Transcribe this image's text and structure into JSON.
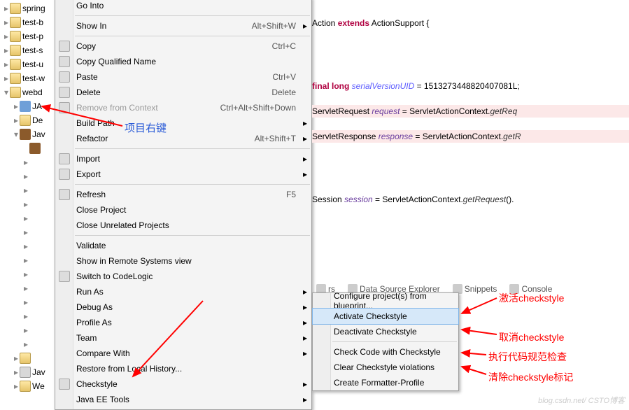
{
  "tree": {
    "items": [
      {
        "label": "spring",
        "icon": "ic-folder",
        "indent": 0,
        "tw": "▸"
      },
      {
        "label": "test-b",
        "icon": "ic-folder",
        "indent": 0,
        "tw": "▸"
      },
      {
        "label": "test-p",
        "icon": "ic-folder",
        "indent": 0,
        "tw": "▸"
      },
      {
        "label": "test-s",
        "icon": "ic-folder",
        "indent": 0,
        "tw": "▸"
      },
      {
        "label": "test-u",
        "icon": "ic-folder",
        "indent": 0,
        "tw": "▸"
      },
      {
        "label": "test-w",
        "icon": "ic-folder",
        "indent": 0,
        "tw": "▸"
      },
      {
        "label": "webd",
        "icon": "ic-folder",
        "indent": 0,
        "tw": "▾"
      },
      {
        "label": "JA",
        "icon": "ic-java",
        "indent": 1,
        "tw": "▸"
      },
      {
        "label": "De",
        "icon": "ic-folder",
        "indent": 1,
        "tw": "▸"
      },
      {
        "label": "Jav",
        "icon": "ic-pkg",
        "indent": 1,
        "tw": "▾"
      },
      {
        "label": "",
        "icon": "ic-pkg",
        "indent": 2,
        "tw": ""
      },
      {
        "label": "",
        "icon": "",
        "indent": 2,
        "tw": "▸"
      },
      {
        "label": "",
        "icon": "",
        "indent": 2,
        "tw": "▸"
      },
      {
        "label": "",
        "icon": "",
        "indent": 2,
        "tw": "▸"
      },
      {
        "label": "",
        "icon": "",
        "indent": 2,
        "tw": "▸"
      },
      {
        "label": "",
        "icon": "",
        "indent": 2,
        "tw": "▸"
      },
      {
        "label": "",
        "icon": "",
        "indent": 2,
        "tw": "▸"
      },
      {
        "label": "",
        "icon": "",
        "indent": 2,
        "tw": "▸"
      },
      {
        "label": "",
        "icon": "",
        "indent": 2,
        "tw": "▸"
      },
      {
        "label": "",
        "icon": "",
        "indent": 2,
        "tw": "▸"
      },
      {
        "label": "",
        "icon": "",
        "indent": 2,
        "tw": "▸"
      },
      {
        "label": "",
        "icon": "",
        "indent": 2,
        "tw": "▸"
      },
      {
        "label": "",
        "icon": "",
        "indent": 2,
        "tw": "▸"
      },
      {
        "label": "",
        "icon": "",
        "indent": 2,
        "tw": "▸"
      },
      {
        "label": "",
        "icon": "",
        "indent": 2,
        "tw": "▸"
      },
      {
        "label": "",
        "icon": "ic-folder",
        "indent": 1,
        "tw": "▸"
      },
      {
        "label": "Jav",
        "icon": "ic-lib",
        "indent": 1,
        "tw": "▸"
      },
      {
        "label": "We",
        "icon": "ic-folder",
        "indent": 1,
        "tw": "▸"
      }
    ]
  },
  "menu1": {
    "groups": [
      [
        {
          "label": "Go Into",
          "shortcut": "",
          "sub": false
        }
      ],
      [
        {
          "label": "Show In",
          "shortcut": "Alt+Shift+W",
          "sub": true
        }
      ],
      [
        {
          "label": "Copy",
          "shortcut": "Ctrl+C",
          "sub": false,
          "icon": "copy"
        },
        {
          "label": "Copy Qualified Name",
          "shortcut": "",
          "sub": false,
          "icon": "copy"
        },
        {
          "label": "Paste",
          "shortcut": "Ctrl+V",
          "sub": false,
          "icon": "paste"
        },
        {
          "label": "Delete",
          "shortcut": "Delete",
          "sub": false,
          "icon": "delete"
        },
        {
          "label": "Remove from Context",
          "shortcut": "Ctrl+Alt+Shift+Down",
          "sub": false,
          "disabled": true,
          "icon": "remove"
        },
        {
          "label": "Build Path",
          "shortcut": "",
          "sub": true
        },
        {
          "label": "Refactor",
          "shortcut": "Alt+Shift+T",
          "sub": true
        }
      ],
      [
        {
          "label": "Import",
          "shortcut": "",
          "sub": true,
          "icon": "import"
        },
        {
          "label": "Export",
          "shortcut": "",
          "sub": true,
          "icon": "export"
        }
      ],
      [
        {
          "label": "Refresh",
          "shortcut": "F5",
          "sub": false,
          "icon": "refresh"
        },
        {
          "label": "Close Project",
          "shortcut": "",
          "sub": false
        },
        {
          "label": "Close Unrelated Projects",
          "shortcut": "",
          "sub": false
        }
      ],
      [
        {
          "label": "Validate",
          "shortcut": "",
          "sub": false
        },
        {
          "label": "Show in Remote Systems view",
          "shortcut": "",
          "sub": false
        },
        {
          "label": "Switch to CodeLogic",
          "shortcut": "",
          "sub": false,
          "icon": "codelogic"
        },
        {
          "label": "Run As",
          "shortcut": "",
          "sub": true
        },
        {
          "label": "Debug As",
          "shortcut": "",
          "sub": true
        },
        {
          "label": "Profile As",
          "shortcut": "",
          "sub": true
        },
        {
          "label": "Team",
          "shortcut": "",
          "sub": true
        },
        {
          "label": "Compare With",
          "shortcut": "",
          "sub": true
        },
        {
          "label": "Restore from Local History...",
          "shortcut": "",
          "sub": false
        },
        {
          "label": "Checkstyle",
          "shortcut": "",
          "sub": true,
          "icon": "checkstyle"
        },
        {
          "label": "Java EE Tools",
          "shortcut": "",
          "sub": true
        }
      ]
    ]
  },
  "menu2": {
    "items": [
      {
        "label": "Configure project(s) from blueprint..."
      },
      {
        "label": "Activate Checkstyle",
        "hl": true
      },
      {
        "label": "Deactivate Checkstyle"
      },
      {
        "sep": true
      },
      {
        "label": "Check Code with Checkstyle"
      },
      {
        "label": "Clear Checkstyle violations"
      },
      {
        "label": "Create Formatter-Profile"
      }
    ]
  },
  "code": {
    "lines": [
      {
        "text": "Action ",
        "kw": "extends",
        "type": " ActionSupport {"
      },
      {
        "text": ""
      },
      {
        "text": ""
      },
      {
        "text": ""
      },
      {
        "text": ""
      },
      {
        "pre": " ",
        "kw": "final long",
        "var": " serialVersionUID",
        "rest": " = 1513273448820407081L;"
      },
      {
        "text": ""
      },
      {
        "hl": true,
        "pre": "ServletRequest ",
        "var2": "request",
        "rest": " = ServletActionContext.",
        "m": "getReq"
      },
      {
        "text": ""
      },
      {
        "hl": true,
        "pre": "ServletResponse ",
        "var2": "response",
        "rest": " = ServletActionContext.",
        "m": "getR"
      },
      {
        "text": ""
      },
      {
        "text": ""
      },
      {
        "text": ""
      },
      {
        "text": ""
      },
      {
        "pre": "Session ",
        "var2": "session",
        "rest": " = ServletActionContext.",
        "m": "getRequest",
        "tail": "()."
      }
    ]
  },
  "tabs": {
    "items": [
      {
        "label": "rs"
      },
      {
        "label": "Data Source Explorer"
      },
      {
        "label": "Snippets"
      },
      {
        "label": "Console"
      }
    ]
  },
  "annotations": {
    "project_right_click": "项目右键",
    "activate": "激活checkstyle",
    "deactivate": "取消checkstyle",
    "check": "执行代码规范检查",
    "clear": "清除checkstyle标记"
  },
  "watermark": "blog.csdn.net/  CSTO博客"
}
